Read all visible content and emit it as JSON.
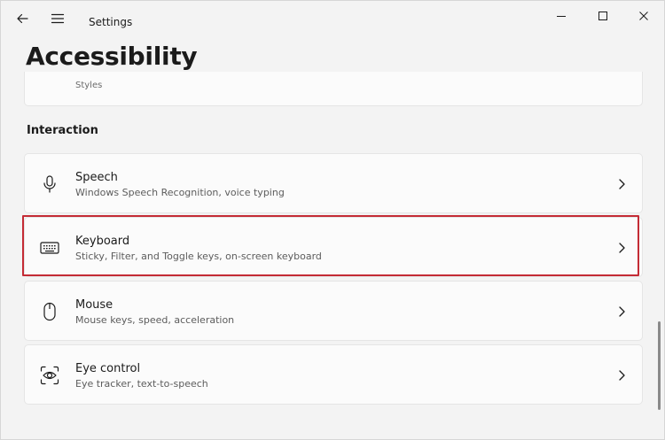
{
  "window": {
    "app_title": "Settings",
    "page_title": "Accessibility"
  },
  "partial_item": {
    "label": "Styles"
  },
  "section": {
    "header": "Interaction"
  },
  "items": [
    {
      "title": "Speech",
      "description": "Windows Speech Recognition, voice typing",
      "icon": "microphone-icon"
    },
    {
      "title": "Keyboard",
      "description": "Sticky, Filter, and Toggle keys, on-screen keyboard",
      "icon": "keyboard-icon",
      "highlighted": true
    },
    {
      "title": "Mouse",
      "description": "Mouse keys, speed, acceleration",
      "icon": "mouse-icon"
    },
    {
      "title": "Eye control",
      "description": "Eye tracker, text-to-speech",
      "icon": "eye-control-icon"
    }
  ],
  "colors": {
    "background": "#f3f3f3",
    "card": "#fbfbfb",
    "highlight": "#c42b35"
  }
}
